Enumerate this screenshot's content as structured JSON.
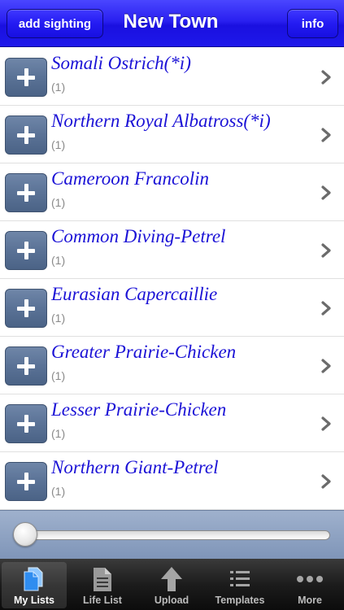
{
  "navbar": {
    "add_label": "add sighting",
    "title": "New Town",
    "info_label": "info"
  },
  "birds": [
    {
      "name": "Somali Ostrich(*i)",
      "count": "(1)"
    },
    {
      "name": "Northern Royal Albatross(*i)",
      "count": "(1)"
    },
    {
      "name": "Cameroon Francolin",
      "count": "(1)"
    },
    {
      "name": "Common Diving-Petrel",
      "count": "(1)"
    },
    {
      "name": "Eurasian Capercaillie",
      "count": "(1)"
    },
    {
      "name": "Greater Prairie-Chicken",
      "count": "(1)"
    },
    {
      "name": "Lesser Prairie-Chicken",
      "count": "(1)"
    },
    {
      "name": "Northern Giant-Petrel",
      "count": "(1)"
    }
  ],
  "slider": {
    "value": 0
  },
  "tabs": [
    {
      "label": "My Lists",
      "icon": "documents-icon",
      "active": true
    },
    {
      "label": "Life List",
      "icon": "document-icon",
      "active": false
    },
    {
      "label": "Upload",
      "icon": "upload-arrow-icon",
      "active": false
    },
    {
      "label": "Templates",
      "icon": "list-icon",
      "active": false
    },
    {
      "label": "More",
      "icon": "more-dots-icon",
      "active": false
    }
  ],
  "colors": {
    "nav_blue": "#2a20f0",
    "bird_name": "#1b12d6",
    "add_button": "#5a7296"
  }
}
